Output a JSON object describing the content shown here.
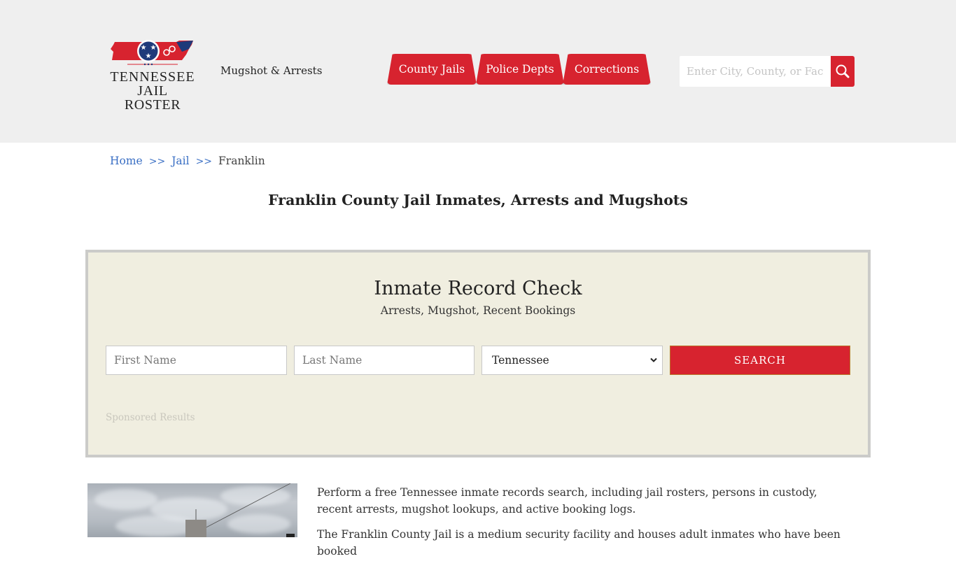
{
  "header": {
    "logo": {
      "line1": "TENNESSEE",
      "line2": "JAIL ROSTER",
      "flag_red": "#d7232f",
      "flag_blue": "#1f3a7a"
    },
    "tagline": "Mugshot & Arrests",
    "nav": [
      {
        "label": "County Jails"
      },
      {
        "label": "Police Depts"
      },
      {
        "label": "Corrections"
      }
    ],
    "search": {
      "placeholder": "Enter City, County, or Facility",
      "icon": "search-icon"
    }
  },
  "breadcrumb": {
    "items": [
      {
        "label": "Home"
      },
      {
        "label": "Jail"
      }
    ],
    "separator": ">>",
    "current": "Franklin"
  },
  "page_title": "Franklin County Jail Inmates, Arrests and Mugshots",
  "record_check": {
    "title": "Inmate Record Check",
    "subtitle": "Arrests, Mugshot, Recent Bookings",
    "first_name_placeholder": "First Name",
    "last_name_placeholder": "Last Name",
    "state_selected": "Tennessee",
    "search_label": "SEARCH",
    "sponsored_label": "Sponsored Results"
  },
  "content": {
    "image_alt": "Franklin County Jail building under cloudy sky",
    "paragraphs": [
      "Perform a free Tennessee inmate records search, including jail rosters, persons in custody, recent arrests, mugshot lookups, and active booking logs.",
      "The Franklin County Jail is a medium security facility and houses adult inmates who have been booked"
    ]
  },
  "colors": {
    "accent": "#d7232f",
    "link": "#3a6fc4",
    "panel_bg": "#f0eee0",
    "header_bg": "#efefef"
  }
}
